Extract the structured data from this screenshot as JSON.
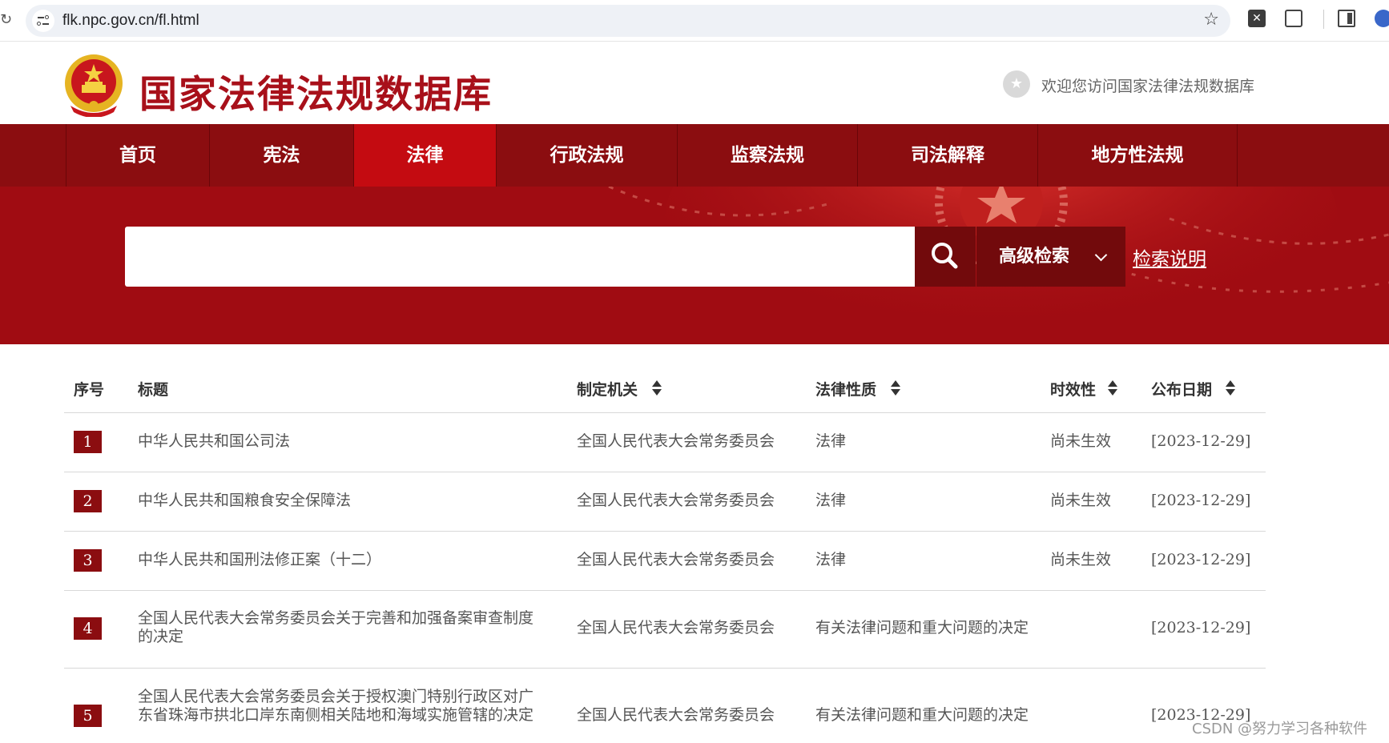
{
  "browser": {
    "url": "flk.npc.gov.cn/fl.html"
  },
  "header": {
    "title": "国家法律法规数据库",
    "welcome": "欢迎您访问国家法律法规数据库"
  },
  "nav": {
    "items": [
      "首页",
      "宪法",
      "法律",
      "行政法规",
      "监察法规",
      "司法解释",
      "地方性法规"
    ],
    "active": "法律"
  },
  "search": {
    "value": "",
    "advanced_label": "高级检索",
    "help_label": "检索说明"
  },
  "table": {
    "headers": {
      "index": "序号",
      "title": "标题",
      "authority": "制定机关",
      "nature": "法律性质",
      "validity": "时效性",
      "date": "公布日期"
    },
    "rows": [
      {
        "index": "1",
        "title": "中华人民共和国公司法",
        "authority": "全国人民代表大会常务委员会",
        "nature": "法律",
        "validity": "尚未生效",
        "date": "[2023-12-29]"
      },
      {
        "index": "2",
        "title": "中华人民共和国粮食安全保障法",
        "authority": "全国人民代表大会常务委员会",
        "nature": "法律",
        "validity": "尚未生效",
        "date": "[2023-12-29]"
      },
      {
        "index": "3",
        "title": "中华人民共和国刑法修正案（十二）",
        "authority": "全国人民代表大会常务委员会",
        "nature": "法律",
        "validity": "尚未生效",
        "date": "[2023-12-29]"
      },
      {
        "index": "4",
        "title": "全国人民代表大会常务委员会关于完善和加强备案审查制度的决定",
        "authority": "全国人民代表大会常务委员会",
        "nature": "有关法律问题和重大问题的决定",
        "validity": "",
        "date": "[2023-12-29]"
      },
      {
        "index": "5",
        "title": "全国人民代表大会常务委员会关于授权澳门特别行政区对广东省珠海市拱北口岸东南侧相关陆地和海域实施管辖的决定",
        "authority": "全国人民代表大会常务委员会",
        "nature": "有关法律问题和重大问题的决定",
        "validity": "",
        "date": "[2023-12-29]"
      }
    ]
  },
  "watermark": "CSDN @努力学习各种软件",
  "colors": {
    "brand_red": "#a8101a",
    "nav_bg": "#8b0d10",
    "nav_active": "#c40b11",
    "banner_bg": "#a00c12"
  }
}
